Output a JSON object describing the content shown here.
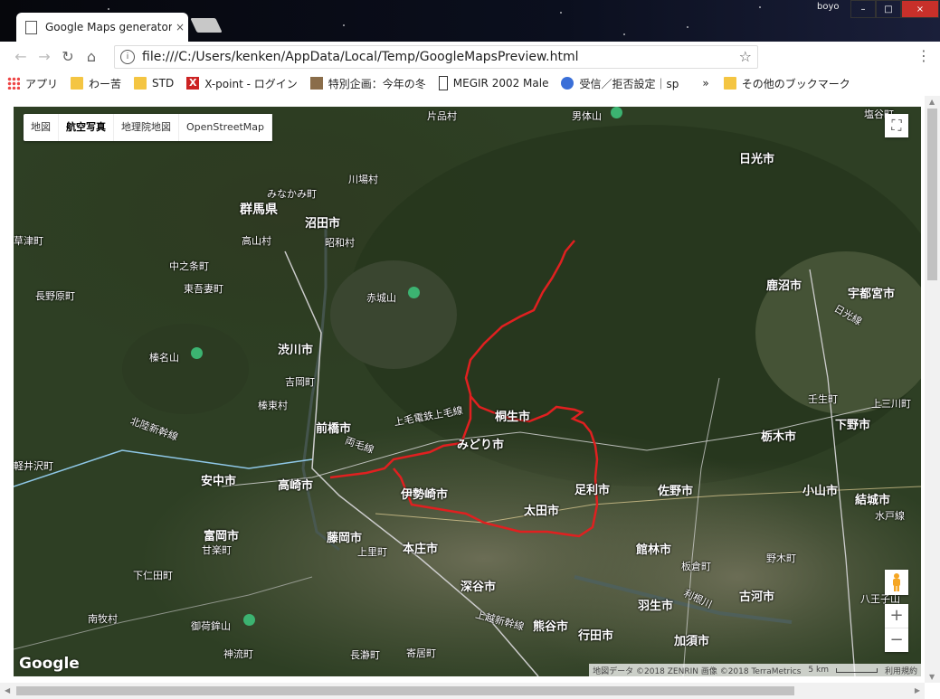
{
  "window": {
    "tab_title": "Google Maps generator",
    "tab_close": "×",
    "user_name": "boyo",
    "min": "–",
    "max": "□",
    "close": "×"
  },
  "toolbar": {
    "back": "←",
    "forward": "→",
    "reload": "↻",
    "home": "⌂",
    "url": "file:///C:/Users/kenken/AppData/Local/Temp/GoogleMapsPreview.html",
    "info": "i",
    "star": "☆",
    "menu": "⋮"
  },
  "bookmarks": {
    "items": [
      {
        "label": "アプリ",
        "icon": "apps-grid-icon"
      },
      {
        "label": "わー苦",
        "icon": "folder-icon"
      },
      {
        "label": "STD",
        "icon": "folder-icon"
      },
      {
        "label": "X-point - ログイン",
        "icon": "x-icon"
      },
      {
        "label": "特別企画：今年の冬",
        "icon": "site-icon"
      },
      {
        "label": "MEGIR 2002 Male",
        "icon": "site-icon"
      },
      {
        "label": "受信／拒否設定｜sp",
        "icon": "site-icon"
      }
    ],
    "overflow": "»",
    "other": "その他のブックマーク"
  },
  "map": {
    "types": [
      "地図",
      "航空写真",
      "地理院地図",
      "OpenStreetMap"
    ],
    "active_type": "航空写真",
    "zoom_in": "+",
    "zoom_out": "−",
    "fullscreen": "⛶",
    "logo": "Google",
    "attribution": "地図データ ©2018 ZENRIN 画像 ©2018 TerraMetrics",
    "scale": "5 km",
    "terms": "利用規約",
    "labels": {
      "gunma": "群馬県",
      "numata": "沼田市",
      "minakami": "みなかみ町",
      "kawaba": "川場村",
      "showa": "昭和村",
      "takayama": "高山村",
      "katashina": "片品村",
      "nakanojo": "中之条町",
      "higashiagatsuma": "東吾妻町",
      "naganohara": "長野原町",
      "kusatsu": "草津町",
      "akagi": "赤城山",
      "haruna": "榛名山",
      "shibukawa": "渋川市",
      "yoshioka": "吉岡町",
      "shinto": "榛東村",
      "maebashi": "前橋市",
      "takasaki": "高崎市",
      "annaka": "安中市",
      "tomioka": "富岡市",
      "kanra": "甘楽町",
      "shimonita": "下仁田町",
      "nanmoku": "南牧村",
      "mikabo": "御荷鉾山",
      "kamikawa": "神流町",
      "isesaki": "伊勢崎市",
      "midori": "みどり市",
      "kiryu": "桐生市",
      "ota": "太田市",
      "ashikaga": "足利市",
      "sano": "佐野市",
      "tatebayashi": "館林市",
      "fujioka": "藤岡市",
      "kamisato": "上里町",
      "honjo": "本庄市",
      "fukaya": "深谷市",
      "kumagaya": "熊谷市",
      "gyoda": "行田市",
      "yorii": "寄居町",
      "nagatoro": "長瀞町",
      "hanyu": "羽生市",
      "kazo": "加須市",
      "koga": "古河市",
      "itakura": "板倉町",
      "tochigi": "栃木市",
      "mibu": "壬生町",
      "shimotsuke": "下野市",
      "kanuma": "鹿沼市",
      "utsunomiya": "宇都宮市",
      "nikko": "日光市",
      "nantai": "男体山",
      "shiobara": "塩谷町",
      "oyama": "小山市",
      "yuki": "結城市",
      "nogi": "野木町",
      "kaminokawa": "上三川町",
      "mitsukaido": "水戸線",
      "karuizawa": "軽井沢町",
      "hokuriku": "北陸新幹線",
      "joetsu": "上越新幹線",
      "ryomo": "両毛線",
      "jomo": "上毛電鉄上毛線",
      "nikko_line": "日光線",
      "tonegawa": "利根川",
      "hachioji": "八王子山"
    }
  }
}
